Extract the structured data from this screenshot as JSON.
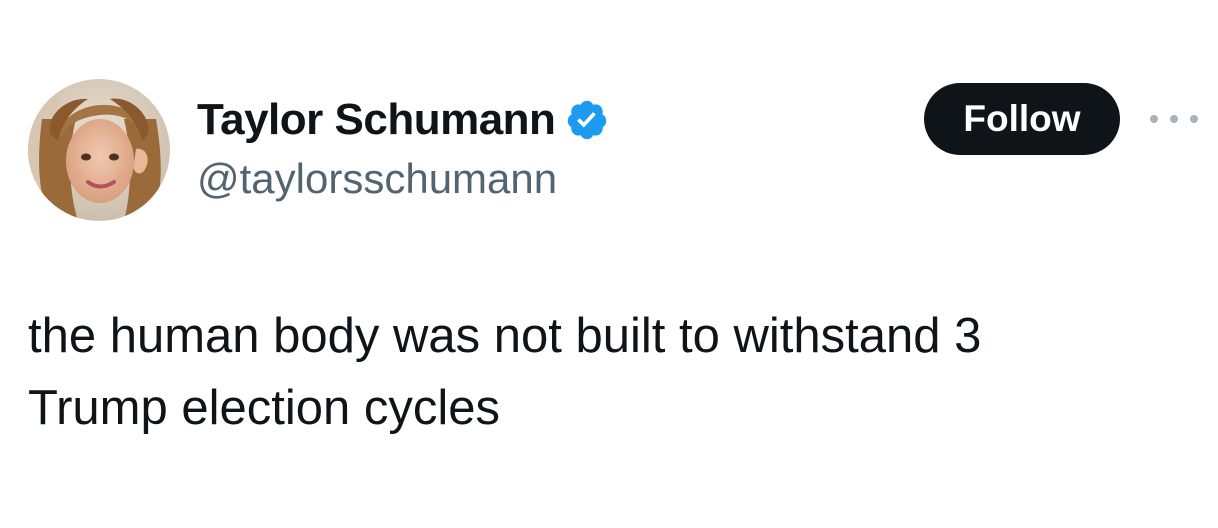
{
  "author": {
    "display_name": "Taylor Schumann",
    "handle": "@taylorsschumann",
    "verified": true,
    "verified_color": "#1d9bf0",
    "avatar_icon": "profile-photo"
  },
  "actions": {
    "follow_label": "Follow",
    "more_icon": "more-horizontal-icon"
  },
  "tweet": {
    "text": "the human body was not built to withstand 3\nTrump election cycles"
  },
  "colors": {
    "text_primary": "#0f1419",
    "text_secondary": "#536471",
    "button_bg": "#0f1419",
    "button_text": "#ffffff"
  }
}
